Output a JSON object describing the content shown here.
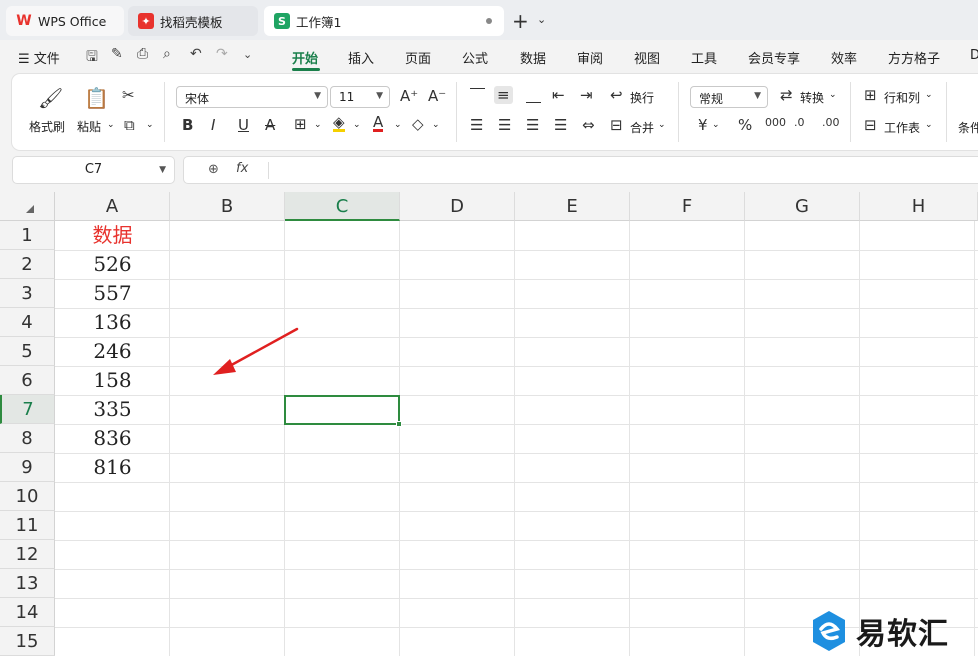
{
  "tabs": [
    {
      "label": "WPS Office",
      "icon": "wps-logo-icon"
    },
    {
      "label": "找稻壳模板",
      "icon": "docer-logo-icon"
    },
    {
      "label": "工作簿1",
      "icon": "spreadsheet-logo-icon",
      "active": true
    }
  ],
  "menu": {
    "file": "文件",
    "items": [
      "开始",
      "插入",
      "页面",
      "公式",
      "数据",
      "审阅",
      "视图",
      "工具",
      "会员专享",
      "效率",
      "方方格子",
      "D"
    ],
    "active": "开始"
  },
  "ribbon": {
    "format_painter": "格式刷",
    "paste": "粘贴",
    "font_name": "宋体",
    "font_size": "11",
    "wrap": "换行",
    "merge": "合并",
    "number_format": "常规",
    "convert": "转换",
    "row_col": "行和列",
    "worksheet": "工作表",
    "cond_format": "条件"
  },
  "formula_bar": {
    "name_box": "C7",
    "fx": "fx",
    "value": ""
  },
  "sheet": {
    "columns": [
      "A",
      "B",
      "C",
      "D",
      "E",
      "F",
      "G",
      "H"
    ],
    "rows": [
      "1",
      "2",
      "3",
      "4",
      "5",
      "6",
      "7",
      "8",
      "9",
      "10",
      "11",
      "12",
      "13",
      "14",
      "15"
    ],
    "selected_cell": "C7",
    "column_a": [
      "数据",
      "526",
      "557",
      "136",
      "246",
      "158",
      "335",
      "836",
      "816"
    ]
  },
  "colors": {
    "accent": "#1a7f4b",
    "header_text": "#e8322d",
    "arrow": "#e02020"
  },
  "watermark": {
    "text": "易软汇"
  }
}
